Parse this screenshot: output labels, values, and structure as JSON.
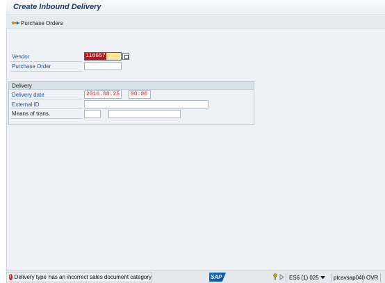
{
  "window": {
    "title": "Create Inbound Delivery"
  },
  "toolbar": {
    "purchase_orders_label": "Purchase Orders"
  },
  "header_fields": {
    "vendor_label": "Vendor",
    "vendor_value": "110657",
    "purchase_order_label": "Purchase Order",
    "purchase_order_value": ""
  },
  "delivery_group": {
    "title": "Delivery",
    "delivery_date_label": "Delivery date",
    "delivery_date_value": "2016.08.25",
    "delivery_time_value": "00:00",
    "external_id_label": "External ID",
    "external_id_value": "",
    "means_of_trans_label": "Means of trans.",
    "means_of_trans_type_value": "",
    "means_of_trans_value": ""
  },
  "status_bar": {
    "message_type": "error",
    "message_field": "Delivery type",
    "message_text": "has an incorrect sales document category",
    "logo_text": "SAP",
    "system_info": "ES6 (1) 025",
    "server": "ptcsvsap040",
    "mode": "OVR"
  },
  "colors": {
    "label_blue": "#1b4fa0",
    "value_red": "#c41c1c",
    "focus_yellow": "#fde59a",
    "error_red": "#c8201e"
  }
}
